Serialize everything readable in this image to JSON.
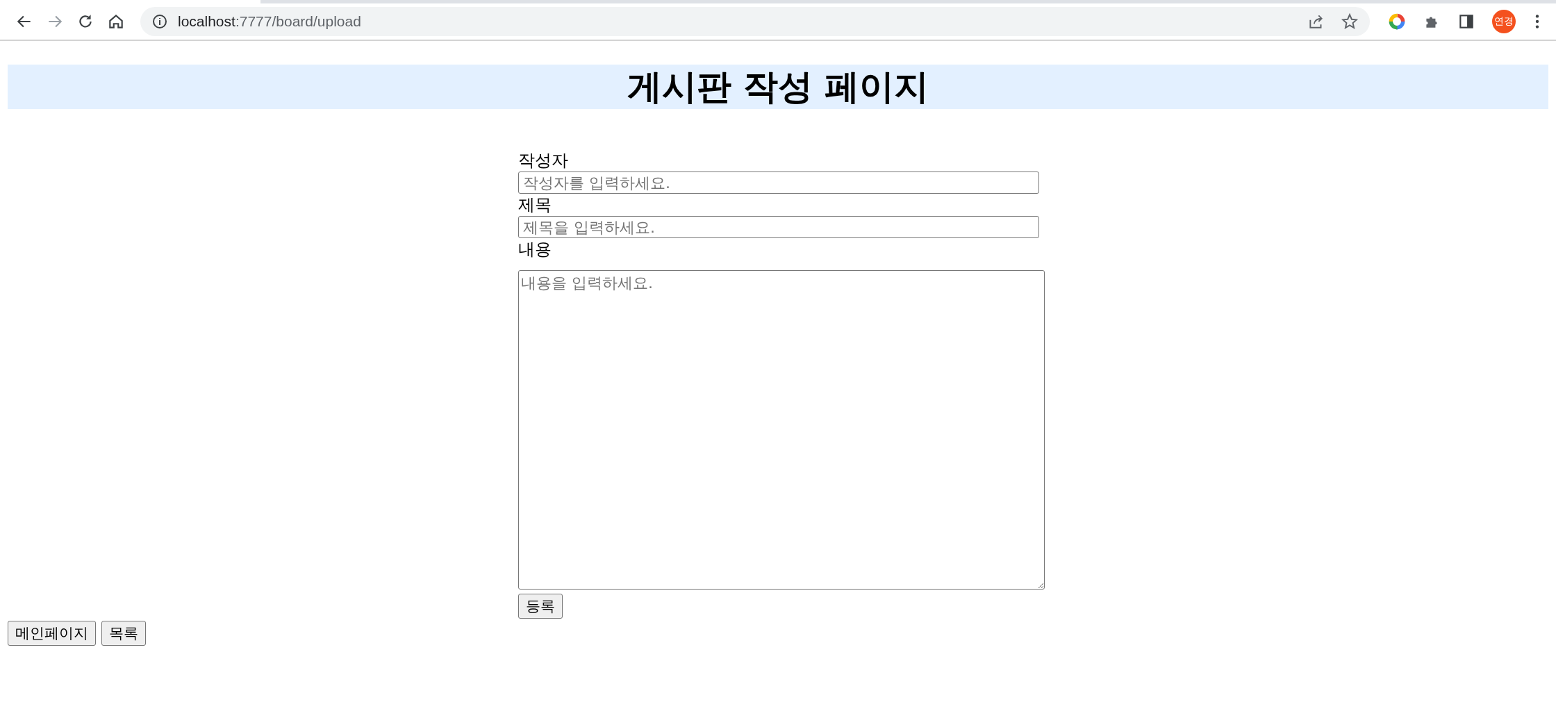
{
  "browser": {
    "back_disabled": false,
    "forward_disabled": true,
    "url_host": "localhost",
    "url_rest": ":7777/board/upload",
    "profile": "연경"
  },
  "page": {
    "title": "게시판 작성 페이지"
  },
  "form": {
    "fields": [
      {
        "kind": "input",
        "label": "작성자",
        "placeholder": "작성자를 입력하세요."
      },
      {
        "kind": "input",
        "label": "제목",
        "placeholder": "제목을 입력하세요."
      },
      {
        "kind": "textarea",
        "label": "내용",
        "placeholder": "내용을 입력하세요."
      }
    ],
    "submit": "등록"
  },
  "nav_buttons": [
    "메인페이지",
    "목록"
  ]
}
